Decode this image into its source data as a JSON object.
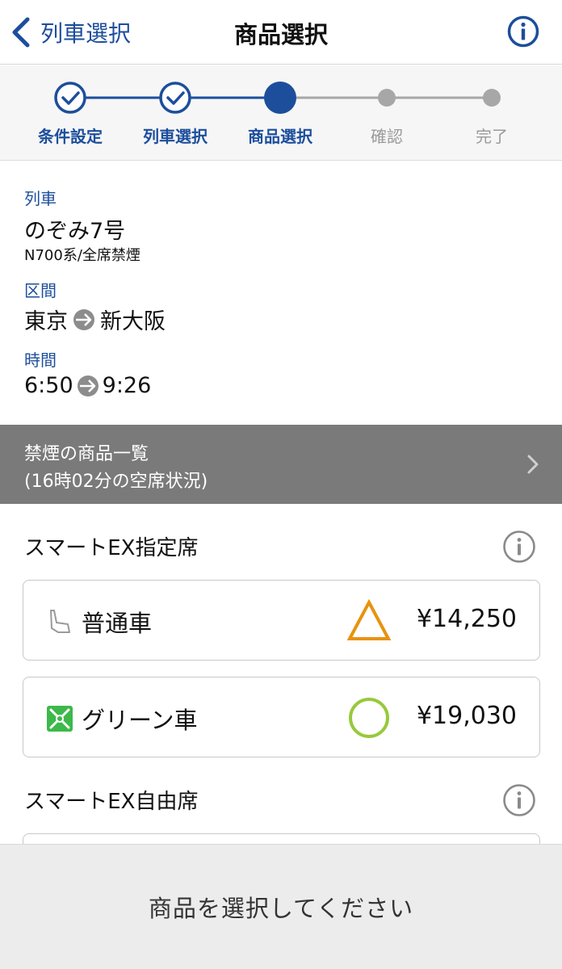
{
  "navbar": {
    "back_label": "列車選択",
    "title": "商品選択",
    "info_icon": "info-circle-icon"
  },
  "stepper": {
    "steps": [
      {
        "label": "条件設定",
        "state": "done"
      },
      {
        "label": "列車選択",
        "state": "done"
      },
      {
        "label": "商品選択",
        "state": "active"
      },
      {
        "label": "確認",
        "state": "todo"
      },
      {
        "label": "完了",
        "state": "todo"
      }
    ]
  },
  "train_info": {
    "train_label": "列車",
    "train_name": "のぞみ7号",
    "train_detail": "N700系/全席禁煙",
    "section_label": "区間",
    "from_station": "東京",
    "to_station": "新大阪",
    "time_label": "時間",
    "depart_time": "6:50",
    "arrive_time": "9:26"
  },
  "banner": {
    "line1": "禁煙の商品一覧",
    "line2": "(16時02分の空席状況)"
  },
  "reserved_section": {
    "title": "スマートEX指定席",
    "cards": [
      {
        "label": "普通車",
        "icon": "seat-icon",
        "status": "triangle-few-seats",
        "price": "¥14,250"
      },
      {
        "label": "グリーン車",
        "icon": "green-car-icon",
        "status": "circle-available",
        "price": "¥19,030"
      }
    ]
  },
  "unreserved_section": {
    "title": "スマートEX自由席"
  },
  "bottom_bar": {
    "message": "商品を選択してください"
  },
  "colors": {
    "accent": "#1c4e9c",
    "banner": "#7a7a7a",
    "triangle": "#e8920e",
    "circle": "#97c93c",
    "green_icon": "#3cb94a"
  }
}
